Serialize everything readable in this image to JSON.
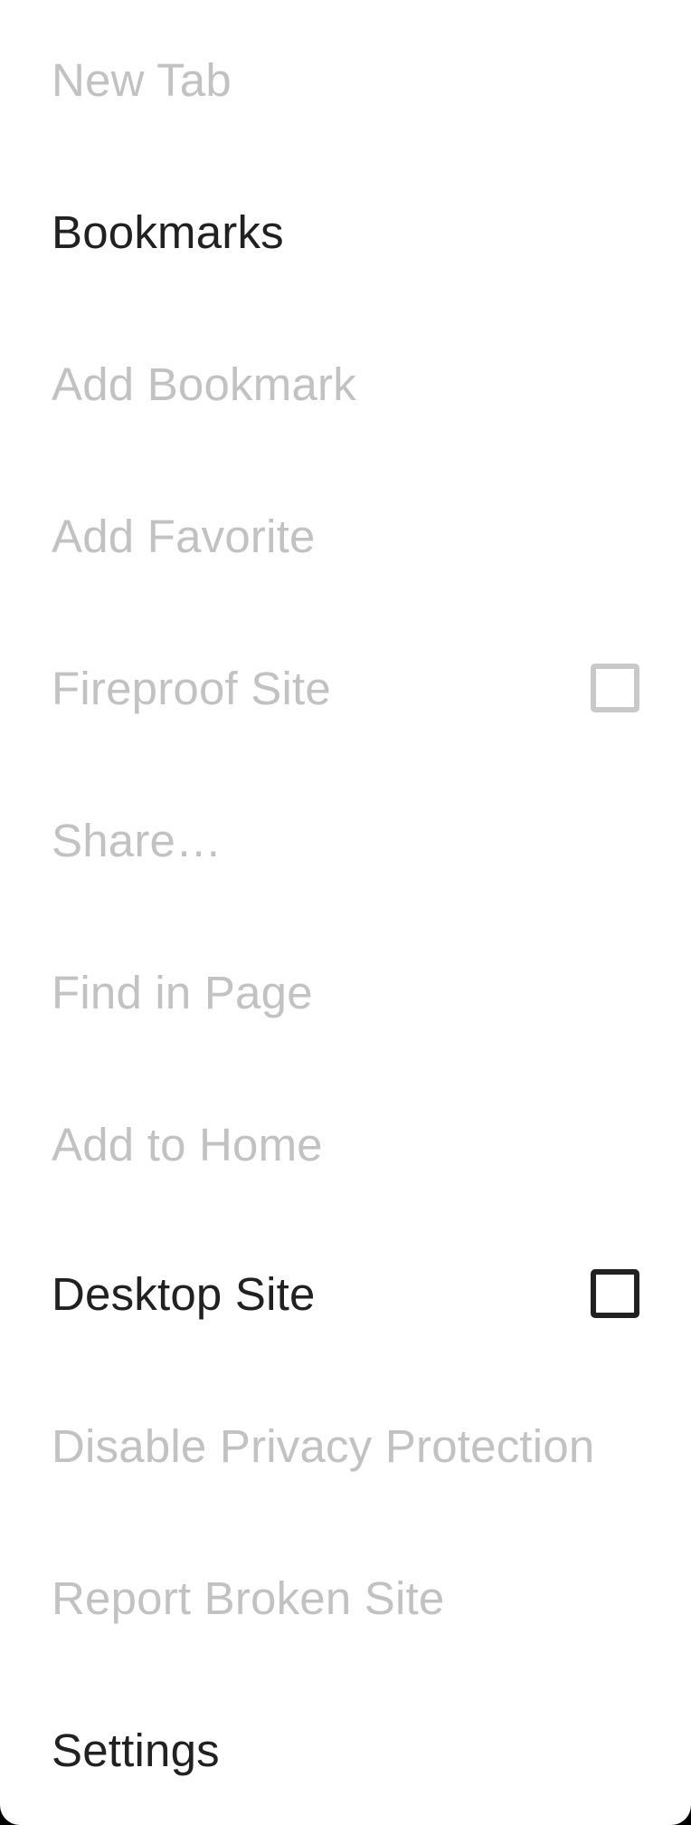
{
  "menu": {
    "items": [
      {
        "label": "New Tab",
        "enabled": false
      },
      {
        "label": "Bookmarks",
        "enabled": true
      },
      {
        "label": "Add Bookmark",
        "enabled": false
      },
      {
        "label": "Add Favorite",
        "enabled": false
      },
      {
        "label": "Fireproof Site",
        "enabled": false,
        "checkbox": true,
        "checked": false
      },
      {
        "label": "Share…",
        "enabled": false
      },
      {
        "label": "Find in Page",
        "enabled": false
      },
      {
        "label": "Add to Home",
        "enabled": false
      },
      {
        "label": "Desktop Site",
        "enabled": true,
        "checkbox": true,
        "checked": false
      },
      {
        "label": "Disable Privacy Protection",
        "enabled": false
      },
      {
        "label": "Report Broken Site",
        "enabled": false
      },
      {
        "label": "Settings",
        "enabled": true
      }
    ]
  },
  "colors": {
    "background": "#ffffff",
    "text_enabled": "#212121",
    "text_disabled": "#c2c2c2"
  }
}
